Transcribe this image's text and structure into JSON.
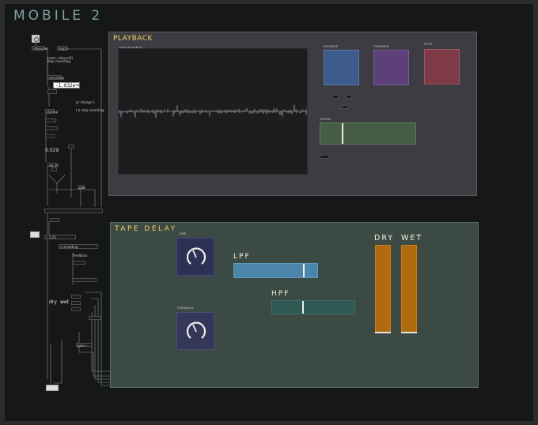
{
  "title": "MOBILE 2",
  "patch": {
    "number_value": "-1.632e+06",
    "number_value2": "0.029",
    "labels": {
      "l1": "reboucler",
      "l2": "loop 1",
      "l3": "noter, rebour(0)",
      "l4": "stop recording",
      "l5": "recording",
      "l6": "startup",
      "l7": "pr change 1",
      "l8": "t b stop recording",
      "l9": "startup",
      "l10": "rec $1",
      "l11": "play",
      "l12": "r, 0.25",
      "l13": "s recording",
      "l14": "feedback",
      "l15": "dry",
      "l16": "wet",
      "l17": "open",
      "l18": "delay",
      "l19": "dry",
      "l20": "wet",
      "l21": "gain~"
    }
  },
  "playback": {
    "title": "PLAYBACK",
    "waveform_label": "rrost recording",
    "pads": [
      {
        "label": "REVERSE",
        "color": "#3e5b8e"
      },
      {
        "label": "FORWARD",
        "color": "#5d3f7a"
      },
      {
        "label": "STOP",
        "color": "#7e3b47"
      }
    ],
    "speed": {
      "label": "SPEED",
      "value": 0.23,
      "color": "#465d45"
    }
  },
  "tape_delay": {
    "title": "TAPE DELAY",
    "time_knob": {
      "label": "TIME",
      "color": "#2e3156"
    },
    "feedback_knob": {
      "label": "FEEDBACK",
      "color": "#353758"
    },
    "lpf": {
      "label": "LPF",
      "value": 0.84,
      "color": "#4b86aa"
    },
    "hpf": {
      "label": "HPF",
      "value": 0.37,
      "color": "#2e5a54"
    },
    "dry": {
      "label": "DRY",
      "value": 1.0
    },
    "wet": {
      "label": "WET",
      "value": 1.0
    }
  }
}
